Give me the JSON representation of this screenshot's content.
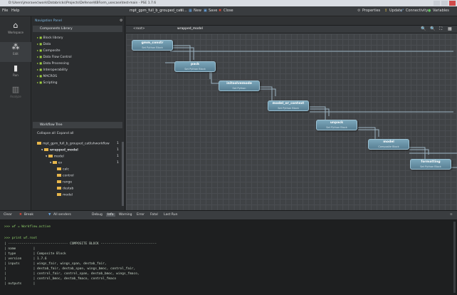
{
  "window": {
    "title": "D:\\Users\\jmoravec\\work\\Databricks\\Projects\\Defense\\KBForm_usecase\\test-main - PSE 1.7.6"
  },
  "menu": [
    "File",
    "Help"
  ],
  "toolbar": {
    "tab_label": "mpt_gpm_full_b_grouped_catli...",
    "new": "New",
    "save": "Save",
    "close": "Close",
    "properties": "Properties",
    "update": "Update",
    "connectivity": "Connectivity",
    "variables": "Variables"
  },
  "breadcrumb": {
    "root": "<root>",
    "current": "wrapped_model"
  },
  "left_tools": [
    {
      "label": "Workspace",
      "icon": "home-icon"
    },
    {
      "label": "Edit",
      "icon": "edit-icon"
    },
    {
      "label": "Run",
      "icon": "run-icon"
    },
    {
      "label": "Analyze",
      "icon": "analyze-icon"
    }
  ],
  "nav": {
    "title": "Navigation Panel",
    "components_header": "Components Library",
    "components": [
      "Block library",
      "Data",
      "Composite",
      "Data Flow Control",
      "Data Processing",
      "Interoperability",
      "MACROS",
      "Scripting"
    ],
    "workflow_header": "Workflow Tree",
    "collapse": "Collapse all",
    "expand": "Expand all",
    "tree": [
      {
        "label": "mpt_gpm_full_b_grouped_catlishworkflow",
        "count": "1"
      },
      {
        "label": "wrapped_model",
        "count": "1"
      },
      {
        "label": "model",
        "count": "1"
      },
      {
        "label": "ev",
        "count": "1"
      },
      {
        "label": "calc",
        "count": ""
      },
      {
        "label": "control",
        "count": ""
      },
      {
        "label": "range",
        "count": ""
      },
      {
        "label": "destab",
        "count": ""
      },
      {
        "label": "model",
        "count": ""
      }
    ]
  },
  "nodes": [
    {
      "title": "gmm_constr",
      "sub": "Set Python Block"
    },
    {
      "title": "pack",
      "sub": "Set Python Block"
    },
    {
      "title": "initsolvemode",
      "sub": "Set Python"
    },
    {
      "title": "model_or_context",
      "sub": "Set Python Block"
    },
    {
      "title": "unpack",
      "sub": "Set Python Block"
    },
    {
      "title": "model",
      "sub": "Composite Block"
    },
    {
      "title": "formatting",
      "sub": "Set Python Block"
    }
  ],
  "log": {
    "buttons": [
      "Clear",
      "Break",
      "All senders",
      "Debug",
      "Info",
      "Warning",
      "Error",
      "Fatal",
      "Last Run"
    ]
  },
  "console_lines": [
    ">>> wf = Workflow.active",
    "",
    ">>> print wf.root",
    "| ------------------------------- COMPOSITE BLOCK -----------------------------",
    "| name         |",
    "| type         | Composite Block",
    "| version      | 1.7.6",
    "| inputs       | wings_fair, wings_span, destab_fair,",
    "|              | destab_fair, destab_span, wings_bmoc, control_fair,",
    "|              | control_fair, control_span, destab_bmoc, wings_fmaco,",
    "|              | control_bmoc, destab_fmaco, control_fmaco",
    "| outputs      |"
  ]
}
